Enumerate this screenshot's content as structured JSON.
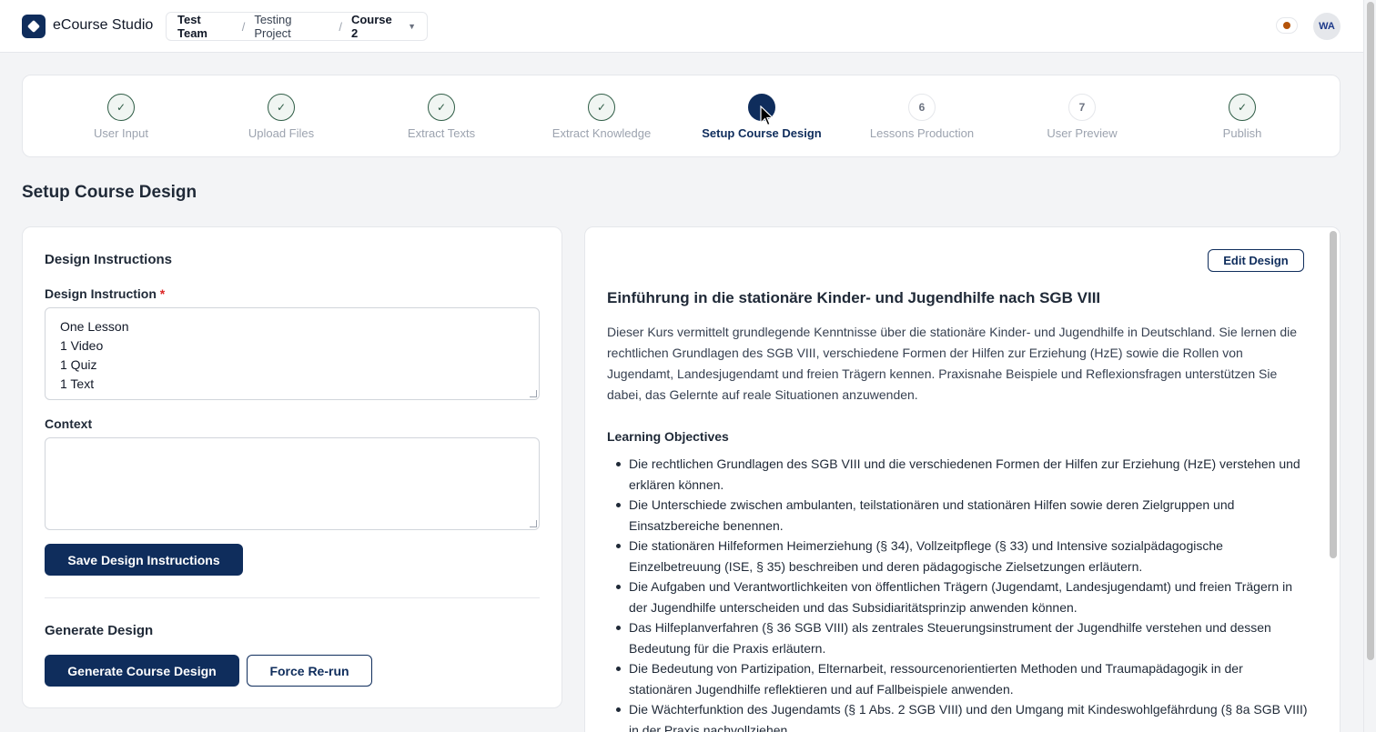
{
  "header": {
    "app_title": "eCourse Studio",
    "breadcrumb": {
      "team": "Test Team",
      "project": "Testing Project",
      "course": "Course 2",
      "separator": "/"
    },
    "avatar_initials": "WA"
  },
  "stepper": {
    "steps": [
      {
        "label": "User Input",
        "state": "done",
        "marker": "✓"
      },
      {
        "label": "Upload Files",
        "state": "done",
        "marker": "✓"
      },
      {
        "label": "Extract Texts",
        "state": "done",
        "marker": "✓"
      },
      {
        "label": "Extract Knowledge",
        "state": "done",
        "marker": "✓"
      },
      {
        "label": "Setup Course Design",
        "state": "active",
        "marker": ""
      },
      {
        "label": "Lessons Production",
        "state": "todo",
        "marker": "6"
      },
      {
        "label": "User Preview",
        "state": "todo",
        "marker": "7"
      },
      {
        "label": "Publish",
        "state": "done",
        "marker": "✓"
      }
    ]
  },
  "page_title": "Setup Course Design",
  "left_panel": {
    "design_instructions_heading": "Design Instructions",
    "design_instruction_label": "Design Instruction",
    "required_marker": "*",
    "design_instruction_value": "One Lesson\n1 Video\n1 Quiz\n1 Text",
    "context_label": "Context",
    "context_value": "",
    "save_button": "Save Design Instructions",
    "generate_heading": "Generate Design",
    "generate_button": "Generate Course Design",
    "force_rerun_button": "Force Re-run"
  },
  "right_panel": {
    "edit_button": "Edit Design",
    "course_title": "Einführung in die stationäre Kinder- und Jugendhilfe nach SGB VIII",
    "course_description": "Dieser Kurs vermittelt grundlegende Kenntnisse über die stationäre Kinder- und Jugendhilfe in Deutschland. Sie lernen die rechtlichen Grundlagen des SGB VIII, verschiedene Formen der Hilfen zur Erziehung (HzE) sowie die Rollen von Jugendamt, Landesjugendamt und freien Trägern kennen. Praxisnahe Beispiele und Reflexionsfragen unterstützen Sie dabei, das Gelernte auf reale Situationen anzuwenden.",
    "objectives_heading": "Learning Objectives",
    "objectives": [
      "Die rechtlichen Grundlagen des SGB VIII und die verschiedenen Formen der Hilfen zur Erziehung (HzE) verstehen und erklären können.",
      "Die Unterschiede zwischen ambulanten, teilstationären und stationären Hilfen sowie deren Zielgruppen und Einsatzbereiche benennen.",
      "Die stationären Hilfeformen Heimerziehung (§ 34), Vollzeitpflege (§ 33) und Intensive sozialpädagogische Einzelbetreuung (ISE, § 35) beschreiben und deren pädagogische Zielsetzungen erläutern.",
      "Die Aufgaben und Verantwortlichkeiten von öffentlichen Trägern (Jugendamt, Landesjugendamt) und freien Trägern in der Jugendhilfe unterscheiden und das Subsidiaritätsprinzip anwenden können.",
      "Das Hilfeplanverfahren (§ 36 SGB VIII) als zentrales Steuerungsinstrument der Jugendhilfe verstehen und dessen Bedeutung für die Praxis erläutern.",
      "Die Bedeutung von Partizipation, Elternarbeit, ressourcenorientierten Methoden und Traumapädagogik in der stationären Jugendhilfe reflektieren und auf Fallbeispiele anwenden.",
      "Die Wächterfunktion des Jugendamts (§ 1 Abs. 2 SGB VIII) und den Umgang mit Kindeswohlgefährdung (§ 8a SGB VIII) in der Praxis nachvollziehen."
    ]
  },
  "icons": {
    "logo": "diamond-logo-icon",
    "breadcrumb_chevron": "chevron-down-icon",
    "status": "status-dot-icon",
    "step_done": "check-icon",
    "cursor": "mouse-pointer-icon"
  },
  "colors": {
    "primary": "#0f2d5c",
    "done_green": "#2f5d46",
    "status_dot": "#b45309",
    "required": "#dc2626"
  }
}
